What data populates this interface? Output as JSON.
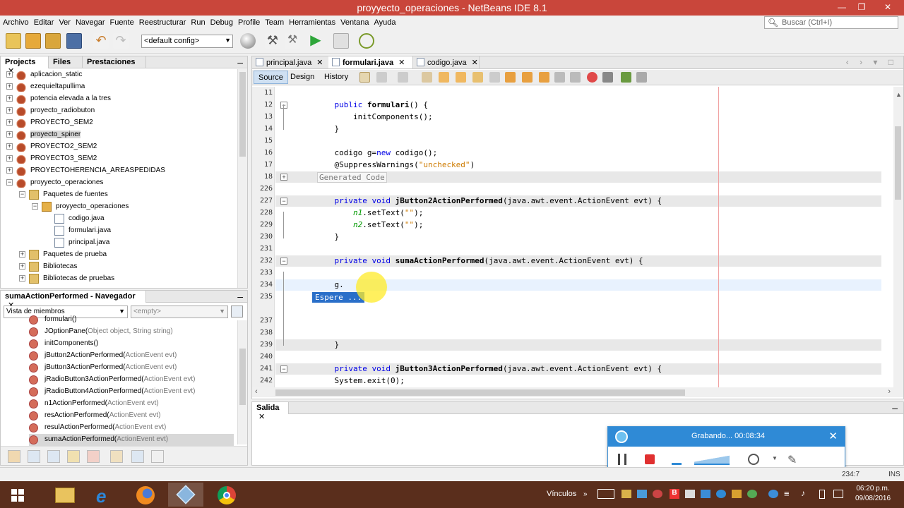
{
  "window": {
    "title": "proyyecto_operaciones - NetBeans IDE 8.1",
    "controls": [
      "—",
      "❐",
      "✕"
    ]
  },
  "menu": [
    "Archivo",
    "Editar",
    "Ver",
    "Navegar",
    "Fuente",
    "Reestructurar",
    "Run",
    "Debug",
    "Profile",
    "Team",
    "Herramientas",
    "Ventana",
    "Ayuda"
  ],
  "search": {
    "placeholder": "Buscar (Ctrl+I)"
  },
  "toolbar": {
    "config": "<default config>"
  },
  "projects_panel": {
    "tabs": [
      "Projects",
      "Files",
      "Prestaciones"
    ],
    "tab_close": "✕",
    "items": [
      {
        "label": "aplicacion_static",
        "level": 0,
        "type": "project",
        "expander": "+"
      },
      {
        "label": "ezequieltapullima",
        "level": 0,
        "type": "project",
        "expander": "+"
      },
      {
        "label": "potencia elevada a la tres",
        "level": 0,
        "type": "project",
        "expander": "+"
      },
      {
        "label": "proyecto_radiobuton",
        "level": 0,
        "type": "project",
        "expander": "+"
      },
      {
        "label": "PROYECTO_SEM2",
        "level": 0,
        "type": "project",
        "expander": "+"
      },
      {
        "label": "proyecto_spiner",
        "level": 0,
        "type": "project",
        "expander": "+",
        "selected": true
      },
      {
        "label": "PROYECTO2_SEM2",
        "level": 0,
        "type": "project",
        "expander": "+"
      },
      {
        "label": "PROYECTO3_SEM2",
        "level": 0,
        "type": "project",
        "expander": "+"
      },
      {
        "label": "PROYECTOHERENCIA_AREASPEDIDAS",
        "level": 0,
        "type": "project",
        "expander": "+"
      },
      {
        "label": "proyyecto_operaciones",
        "level": 0,
        "type": "project",
        "expander": "−"
      },
      {
        "label": "Paquetes de fuentes",
        "level": 1,
        "type": "folder",
        "expander": "−"
      },
      {
        "label": "proyyecto_operaciones",
        "level": 2,
        "type": "package",
        "expander": "−"
      },
      {
        "label": "codigo.java",
        "level": 3,
        "type": "file",
        "expander": ""
      },
      {
        "label": "formulari.java",
        "level": 3,
        "type": "file",
        "expander": ""
      },
      {
        "label": "principal.java",
        "level": 3,
        "type": "file",
        "expander": ""
      },
      {
        "label": "Paquetes de prueba",
        "level": 1,
        "type": "folder",
        "expander": "+"
      },
      {
        "label": "Bibliotecas",
        "level": 1,
        "type": "folder",
        "expander": "+"
      },
      {
        "label": "Bibliotecas de pruebas",
        "level": 1,
        "type": "folder",
        "expander": "+"
      }
    ]
  },
  "navigator": {
    "title": "sumaActionPerformed - Navegador",
    "close": "✕",
    "view": "Vista de miembros",
    "filter": "<empty>",
    "items": [
      {
        "name": "formulari()",
        "params": ""
      },
      {
        "name": "JOptionPane(",
        "params": "Object object, String string)"
      },
      {
        "name": "initComponents()",
        "params": ""
      },
      {
        "name": "jButton2ActionPerformed(",
        "params": "ActionEvent evt)"
      },
      {
        "name": "jButton3ActionPerformed(",
        "params": "ActionEvent evt)"
      },
      {
        "name": "jRadioButton3ActionPerformed(",
        "params": "ActionEvent evt)"
      },
      {
        "name": "jRadioButton4ActionPerformed(",
        "params": "ActionEvent evt)"
      },
      {
        "name": "n1ActionPerformed(",
        "params": "ActionEvent evt)"
      },
      {
        "name": "resActionPerformed(",
        "params": "ActionEvent evt)"
      },
      {
        "name": "resulActionPerformed(",
        "params": "ActionEvent evt)"
      },
      {
        "name": "sumaActionPerformed(",
        "params": "ActionEvent evt)",
        "selected": true
      }
    ]
  },
  "editor": {
    "tabs": [
      {
        "label": "principal.java",
        "active": false
      },
      {
        "label": "formulari.java",
        "active": true
      },
      {
        "label": "codigo.java",
        "active": false
      }
    ],
    "tab_close": "✕",
    "views": [
      "Source",
      "Design",
      "History"
    ],
    "nav_arrows": "‹ › ▾ □",
    "lines": [
      {
        "n": "11",
        "code": ""
      },
      {
        "n": "12",
        "code": "    public formulari() {"
      },
      {
        "n": "13",
        "code": "        initComponents();"
      },
      {
        "n": "14",
        "code": "    }"
      },
      {
        "n": "15",
        "code": ""
      },
      {
        "n": "16",
        "code": "    codigo g=new codigo();"
      },
      {
        "n": "17",
        "code": "    @SuppressWarnings(\"unchecked\")"
      },
      {
        "n": "18",
        "code": "Generated Code"
      },
      {
        "n": "226",
        "code": ""
      },
      {
        "n": "227",
        "code": "    private void jButton2ActionPerformed(java.awt.event.ActionEvent evt) {"
      },
      {
        "n": "228",
        "code": "        n1.setText(\"\");"
      },
      {
        "n": "229",
        "code": "        n2.setText(\"\");"
      },
      {
        "n": "230",
        "code": "    }"
      },
      {
        "n": "231",
        "code": ""
      },
      {
        "n": "232",
        "code": "    private void sumaActionPerformed(java.awt.event.ActionEvent evt) {"
      },
      {
        "n": "233",
        "code": ""
      },
      {
        "n": "234",
        "code": "    g."
      },
      {
        "n": "235",
        "code": ""
      },
      {
        "n": "237",
        "code": ""
      },
      {
        "n": "238",
        "code": ""
      },
      {
        "n": "239",
        "code": "    }"
      },
      {
        "n": "240",
        "code": ""
      },
      {
        "n": "241",
        "code": "    private void jButton3ActionPerformed(java.awt.event.ActionEvent evt) {"
      },
      {
        "n": "242",
        "code": "    System.exit(0);"
      }
    ],
    "popup": "Espere ..."
  },
  "output": {
    "tab": "Salida",
    "close": "✕"
  },
  "recorder": {
    "status": "Grabando... 00:08:34",
    "close": "✕"
  },
  "statusbar": {
    "position": "234:7",
    "mode": "INS"
  },
  "taskbar": {
    "links": "Vínculos",
    "time": "06:20 p.m.",
    "date": "09/08/2016"
  }
}
